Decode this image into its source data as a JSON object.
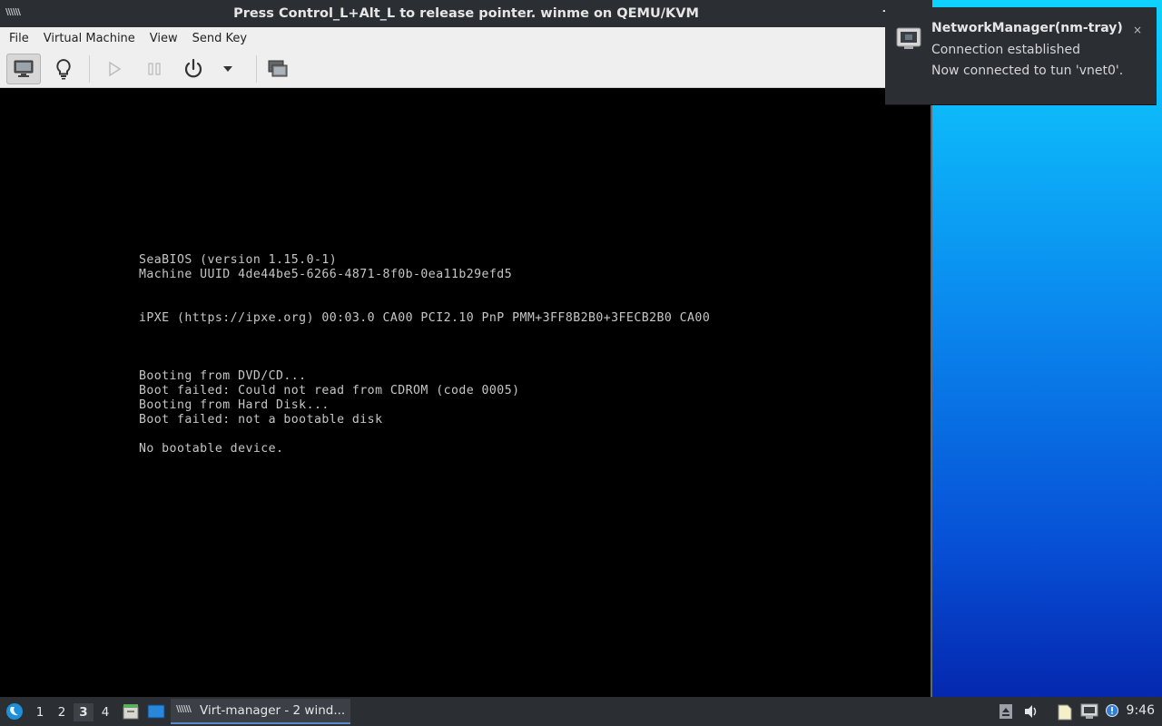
{
  "window": {
    "title": "Press Control_L+Alt_L to release pointer. winme on QEMU/KVM",
    "app_icon": "virt-manager-icon"
  },
  "menubar": {
    "items": [
      "File",
      "Virtual Machine",
      "View",
      "Send Key"
    ]
  },
  "toolbar": {
    "buttons": [
      {
        "name": "console-view-icon",
        "active": true
      },
      {
        "name": "details-lightbulb-icon",
        "active": false
      },
      {
        "name": "run-play-icon",
        "active": false,
        "enabled": false
      },
      {
        "name": "pause-icon",
        "active": false,
        "enabled": false
      },
      {
        "name": "power-icon",
        "active": false
      },
      {
        "name": "power-menu-chevron-icon",
        "active": false
      },
      {
        "name": "fullscreen-screens-icon",
        "active": false
      }
    ]
  },
  "console": {
    "lines": [
      "SeaBIOS (version 1.15.0-1)",
      "Machine UUID 4de44be5-6266-4871-8f0b-0ea11b29efd5",
      "iPXE (https://ipxe.org) 00:03.0 CA00 PCI2.10 PnP PMM+3FF8B2B0+3FECB2B0 CA00",
      "Booting from DVD/CD...",
      "Boot failed: Could not read from CDROM (code 0005)",
      "Booting from Hard Disk...",
      "Boot failed: not a bootable disk",
      "No bootable device."
    ]
  },
  "notification": {
    "title": "NetworkManager(nm-tray)",
    "line1": "Connection established",
    "line2": "Now connected to tun 'vnet0'.",
    "close": "×",
    "icon": "network-wired-icon"
  },
  "taskbar": {
    "workspaces": [
      "1",
      "2",
      "3",
      "4"
    ],
    "current_workspace": "3",
    "task_label": "Virt-manager - 2 wind...",
    "clock": "9:46"
  },
  "colors": {
    "panel_bg": "#2b2f34",
    "console_text": "#c6c6c6",
    "desktop_gradient_top": "#0fd2ff",
    "desktop_gradient_bottom": "#0420a8"
  }
}
